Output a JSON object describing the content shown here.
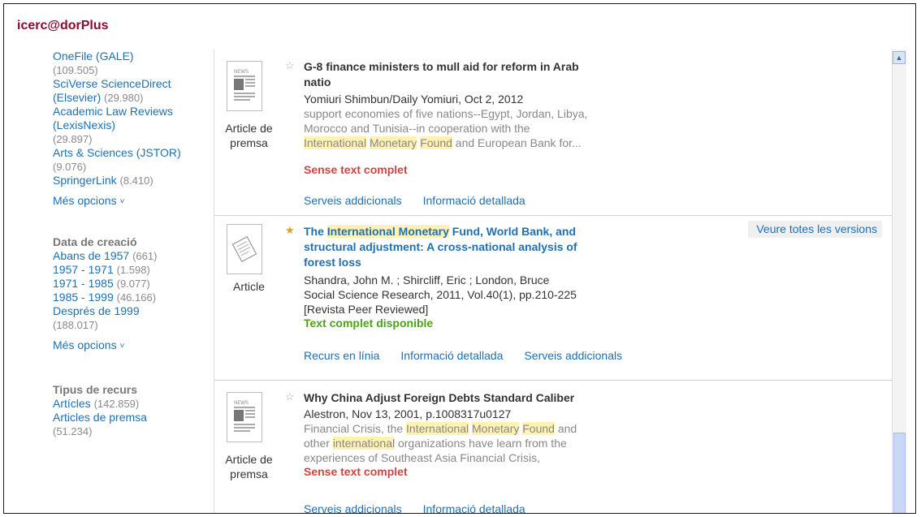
{
  "brand": "icerc@dorPlus",
  "sidebar": {
    "sources": [
      {
        "name": "OneFile (GALE)",
        "count": "(109.505)"
      },
      {
        "name": "SciVerse ScienceDirect (Elsevier)",
        "count": "(29.980)"
      },
      {
        "name": "Academic Law Reviews (LexisNexis)",
        "count": "(29.897)"
      },
      {
        "name": "Arts & Sciences (JSTOR)",
        "count": "(9.076)"
      },
      {
        "name": "SpringerLink",
        "count": "(8.410)"
      }
    ],
    "more_options": "Més opcions",
    "date_section": {
      "title": "Data de creació",
      "items": [
        {
          "label": "Abans de 1957",
          "count": "(661)"
        },
        {
          "label": "1957 - 1971",
          "count": "(1.598)"
        },
        {
          "label": "1971 - 1985",
          "count": "(9.077)"
        },
        {
          "label": "1985 - 1999",
          "count": "(46.166)"
        },
        {
          "label": "Després de 1999",
          "count": "(188.017)"
        }
      ]
    },
    "type_section": {
      "title": "Tipus de recurs",
      "items": [
        {
          "label": "Artícles",
          "count": "(142.859)"
        },
        {
          "label": "Articles de premsa",
          "count": "(51.234)"
        }
      ]
    }
  },
  "results": [
    {
      "type": "Article de premsa",
      "title_lines": [
        "G-8 finance ministers to mull aid for reform in Arab",
        "natio"
      ],
      "source": "Yomiuri Shimbun/Daily Yomiuri, Oct 2, 2012",
      "snippet": [
        "support economies of five nations--Egypt, Jordan, Libya,",
        "Morocco and Tunisia--in cooperation with the"
      ],
      "snippet_hl": {
        "a": "International",
        "b": "Monetary",
        "c": "Found",
        "rest": " and European Bank for..."
      },
      "availability": "Sense text complet",
      "links": [
        "Serveis addicionals",
        "Informació detallada"
      ]
    },
    {
      "type": "Article",
      "title_pre": "The ",
      "title_hl": "International Monetary",
      "title_lines_rest": [
        " Fund, World Bank, and",
        "structural adjustment: A cross-national analysis of",
        "forest loss"
      ],
      "authors": "Shandra, John M. ; Shircliff, Eric ; London, Bruce",
      "source": "Social Science Research, 2011, Vol.40(1), pp.210-225",
      "peer": "[Revista Peer Reviewed]",
      "availability": "Text complet disponible",
      "links": [
        "Recurs en línia",
        "Informació detallada",
        "Serveis addicionals"
      ],
      "versions": "Veure totes les versions"
    },
    {
      "type": "Article de premsa",
      "title": "Why China Adjust Foreign Debts Standard Caliber",
      "source": "Alestron, Nov 13, 2001, p.1008317u0127",
      "snippet_l1_pre": "Financial Crisis, the ",
      "snippet_l1_hl": {
        "a": "International",
        "b": "Monetary",
        "c": "Found"
      },
      "snippet_l1_post": " and",
      "snippet_l2_pre": "other ",
      "snippet_l2_hl": "international",
      "snippet_l2_post": " organizations have learn from the",
      "snippet_l3": "experiences of Southeast Asia Financial Crisis,",
      "availability": "Sense text complet",
      "links": [
        "Serveis addicionals",
        "Informació detallada"
      ]
    }
  ],
  "colors": {
    "brand": "#8a0b2e",
    "link": "#1f6fb2",
    "no_fulltext": "#d64040",
    "fulltext": "#4aa319",
    "highlight": "#fff2b3"
  },
  "icons": {
    "news": "newspaper-icon",
    "article": "article-icon",
    "star_empty": "star-outline-icon",
    "star_full": "star-filled-icon",
    "chevron": "chevron-down-icon",
    "scroll_up": "scroll-up-arrow-icon"
  }
}
